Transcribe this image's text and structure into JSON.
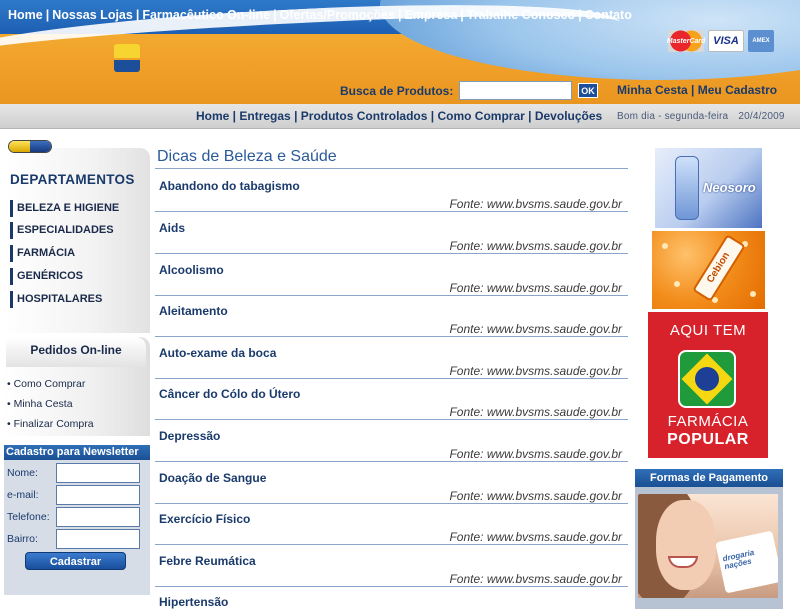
{
  "top_nav": [
    "Home",
    "Nossas Lojas",
    "Farmacêutico On-line",
    "Ofertas/Promoções",
    "Empresa",
    "Trabalhe Conosco",
    "Contato"
  ],
  "payment_cards": [
    {
      "name": "mastercard",
      "label": "MasterCard"
    },
    {
      "name": "visa",
      "label": "VISA"
    },
    {
      "name": "amex",
      "label": "AMEX"
    }
  ],
  "search": {
    "label": "Busca de Produtos:",
    "value": "",
    "button": "OK"
  },
  "account_links": {
    "cart": "Minha Cesta",
    "separator": "|",
    "register": "Meu Cadastro"
  },
  "sub_nav": [
    "Home",
    "Entregas",
    "Produtos Controlados",
    "Como Comprar",
    "Devoluções"
  ],
  "greeting": {
    "text": "Bom dia - segunda-feira",
    "date": "20/4/2009"
  },
  "departments": {
    "title": "DEPARTAMENTOS",
    "items": [
      "BELEZA E HIGIENE",
      "ESPECIALIDADES",
      "FARMÁCIA",
      "GENÉRICOS",
      "HOSPITALARES"
    ]
  },
  "orders": {
    "title": "Pedidos On-line",
    "links": [
      "Como Comprar",
      "Minha Cesta",
      "Finalizar Compra"
    ]
  },
  "newsletter": {
    "title": "Cadastro para Newsletter",
    "fields": [
      {
        "label": "Nome:",
        "value": ""
      },
      {
        "label": "e-mail:",
        "value": ""
      },
      {
        "label": "Telefone:",
        "value": ""
      },
      {
        "label": "Bairro:",
        "value": ""
      }
    ],
    "button": "Cadastrar"
  },
  "main": {
    "title": "Dicas de Beleza e Saúde",
    "topics": [
      {
        "title": "Abandono do tabagismo",
        "source": "Fonte: www.bvsms.saude.gov.br"
      },
      {
        "title": "Aids",
        "source": "Fonte: www.bvsms.saude.gov.br"
      },
      {
        "title": "Alcoolismo",
        "source": "Fonte: www.bvsms.saude.gov.br"
      },
      {
        "title": "Aleitamento",
        "source": "Fonte: www.bvsms.saude.gov.br"
      },
      {
        "title": "Auto-exame da boca",
        "source": "Fonte: www.bvsms.saude.gov.br"
      },
      {
        "title": "Câncer do Cólo do Útero",
        "source": "Fonte: www.bvsms.saude.gov.br"
      },
      {
        "title": "Depressão",
        "source": "Fonte: www.bvsms.saude.gov.br"
      },
      {
        "title": "Doação de Sangue",
        "source": "Fonte: www.bvsms.saude.gov.br"
      },
      {
        "title": "Exercício Físico",
        "source": "Fonte: www.bvsms.saude.gov.br"
      },
      {
        "title": "Febre Reumática",
        "source": "Fonte: www.bvsms.saude.gov.br"
      },
      {
        "title": "Hipertensão",
        "source": ""
      }
    ]
  },
  "ads": {
    "neosoro": "Neosoro",
    "cebion": "Cebion",
    "farmacia_popular": {
      "top": "AQUI TEM",
      "line1": "FARMÁCIA",
      "line2": "POPULAR"
    }
  },
  "payment": {
    "title": "Formas de Pagamento",
    "photo_text": "drogaria nações"
  }
}
